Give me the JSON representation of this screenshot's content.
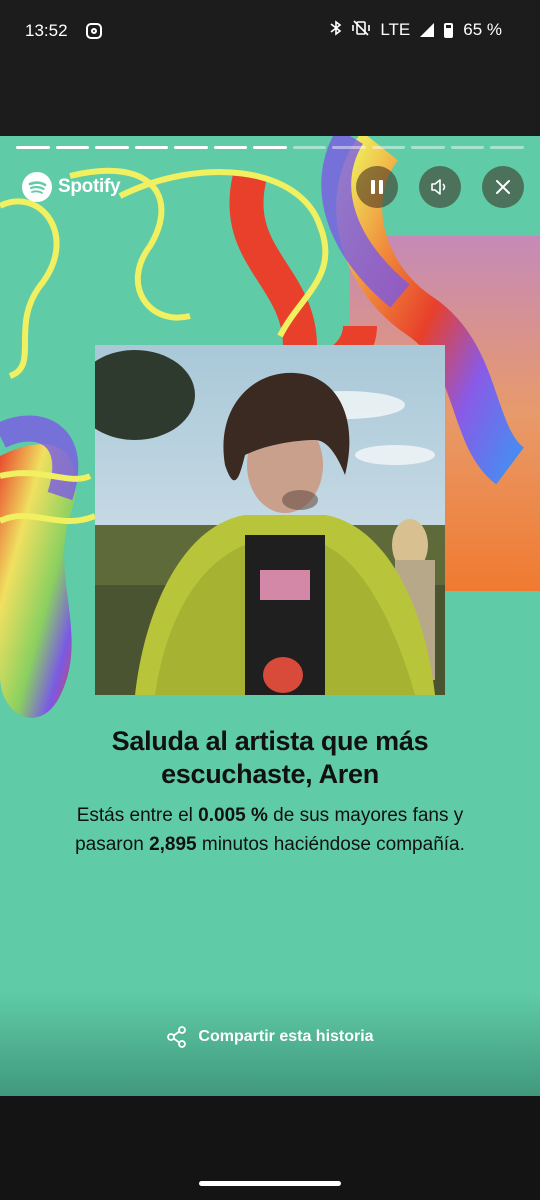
{
  "status_bar": {
    "time": "13:52",
    "network": "LTE",
    "battery": "65 %",
    "icons": [
      "instagram-icon",
      "bluetooth-icon",
      "vibrate-off-icon",
      "signal-icon",
      "battery-icon"
    ]
  },
  "story": {
    "progress": {
      "total_segments": 13,
      "completed_segments": 7
    },
    "brand": "Spotify",
    "controls": [
      "pause-icon",
      "volume-icon",
      "close-icon"
    ],
    "headline": "Saluda al artista que más escuchaste, Aren",
    "sub_parts": {
      "p1": "Estás entre el ",
      "b1": "0.005 %",
      "p2": " de sus mayores fans y pasaron ",
      "b2": "2,895",
      "p3": " minutos haciéndose compañía."
    },
    "share_label": "Compartir esta historia",
    "colors": {
      "background": "#5fcca7",
      "yellow": "#f0f060",
      "red": "#e8402a",
      "purple": "#7a5ae6"
    }
  }
}
